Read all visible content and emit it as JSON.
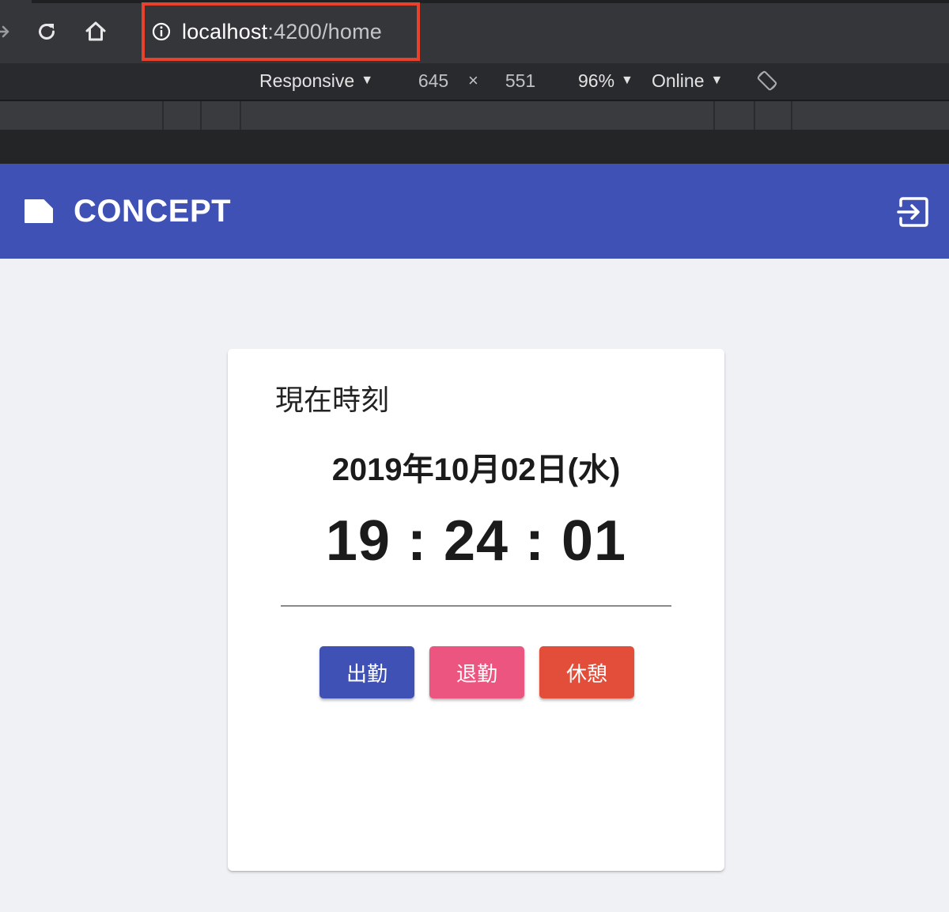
{
  "browser": {
    "url_host": "localhost",
    "url_rest": ":4200/home",
    "icons": [
      "forward-icon",
      "reload-icon",
      "home-icon",
      "info-icon"
    ]
  },
  "device_toolbar": {
    "mode": "Responsive",
    "width": "645",
    "times": "×",
    "height": "551",
    "zoom": "96%",
    "network": "Online",
    "caret": "▼"
  },
  "app": {
    "brand": "CONCEPT",
    "header_color": "#3f51b5"
  },
  "clock": {
    "title": "現在時刻",
    "date": "2019年10月02日(水)",
    "time": "19 : 24 : 01"
  },
  "actions": {
    "clock_in": "出勤",
    "clock_out": "退勤",
    "break": "休憩",
    "colors": {
      "clock_in": "#3f51b5",
      "clock_out": "#ec5580",
      "break": "#e24e39"
    }
  }
}
